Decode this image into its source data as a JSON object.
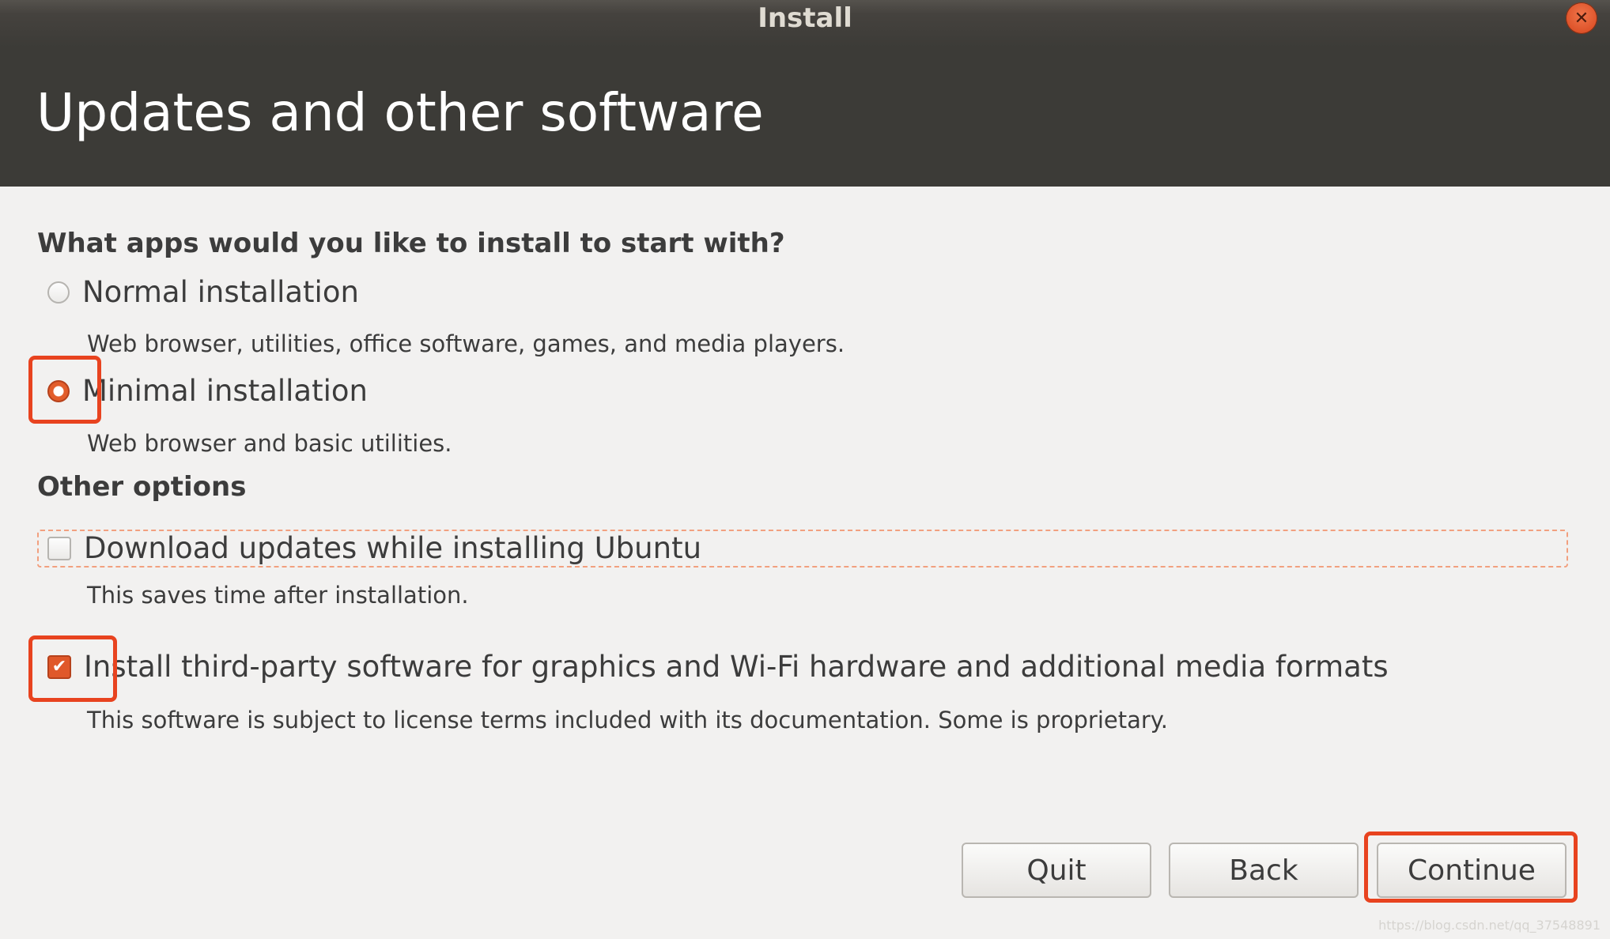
{
  "window": {
    "title": "Install",
    "close_icon": "close-icon",
    "close_glyph": "✕"
  },
  "header": {
    "title": "Updates and other software"
  },
  "apps_section": {
    "title": "What apps would you like to install to start with?",
    "options": [
      {
        "label": "Normal installation",
        "description": "Web browser, utilities, office software, games, and media players.",
        "selected": false
      },
      {
        "label": "Minimal installation",
        "description": "Web browser and basic utilities.",
        "selected": true
      }
    ]
  },
  "other_section": {
    "title": "Other options",
    "options": [
      {
        "label": "Download updates while installing Ubuntu",
        "description": "This saves time after installation.",
        "checked": false
      },
      {
        "label": "Install third-party software for graphics and Wi-Fi hardware and additional media formats",
        "description": "This software is subject to license terms included with its documentation. Some is proprietary.",
        "checked": true,
        "check_glyph": "✔"
      }
    ]
  },
  "buttons": {
    "quit": "Quit",
    "back": "Back",
    "continue": "Continue"
  },
  "watermark": "https://blog.csdn.net/qq_37548891",
  "colors": {
    "accent": "#e0582a",
    "highlight": "#e8431f",
    "header_bg": "#3c3b37",
    "content_bg": "#f2f1f0"
  }
}
